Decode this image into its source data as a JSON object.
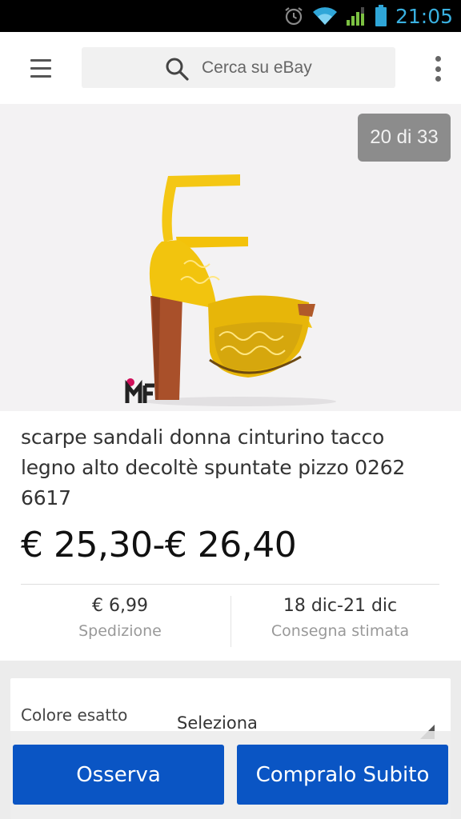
{
  "status_bar": {
    "time": "21:05",
    "icons": [
      "alarm-icon",
      "wifi-icon",
      "signal-icon",
      "battery-icon"
    ]
  },
  "app_bar": {
    "menu_icon": "hamburger-menu-icon",
    "search": {
      "placeholder": "Cerca su eBay",
      "icon": "search-icon"
    },
    "overflow_icon": "more-vert-icon"
  },
  "gallery": {
    "counter": "20 di 33",
    "image": "yellow-lace-platform-sandal",
    "logo": "mf-brand-logo"
  },
  "product": {
    "title": "scarpe sandali donna cinturino tacco legno alto decoltè spuntate pizzo 0262 6617",
    "price": "€ 25,30-€ 26,40"
  },
  "shipping": {
    "cost": "€ 6,99",
    "cost_label": "Spedizione",
    "delivery": "18 dic-21 dic",
    "delivery_label": "Consegna stimata"
  },
  "variant": {
    "label": "Colore esatto",
    "value": "Seleziona"
  },
  "actions": {
    "watch_label": "Osserva",
    "buy_label": "Compralo Subito"
  },
  "colors": {
    "primary_button": "#0a55c4",
    "status_time": "#39b0e0",
    "counter_bg": "#8c8c8c"
  }
}
